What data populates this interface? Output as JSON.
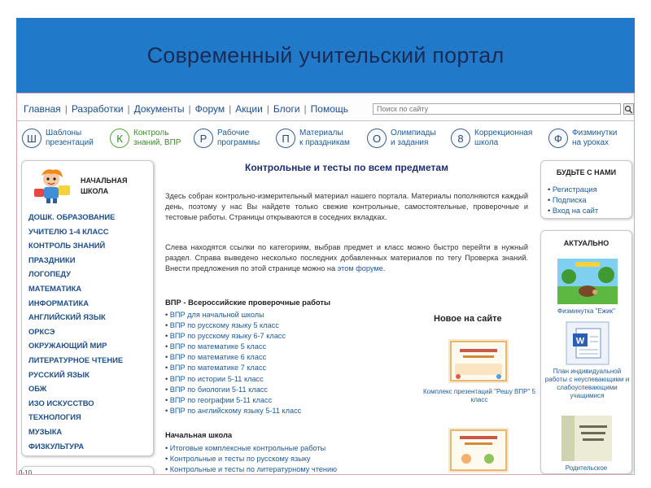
{
  "slide": {
    "title": "Современный учительский портал"
  },
  "topnav": {
    "items": [
      "Главная",
      "Разработки",
      "Документы",
      "Форум",
      "Акции",
      "Блоги",
      "Помощь"
    ],
    "search_placeholder": "Поиск по сайту"
  },
  "categories": [
    {
      "letter": "Ш",
      "line1": "Шаблоны",
      "line2": "презентаций"
    },
    {
      "letter": "К",
      "line1": "Контроль",
      "line2": "знаний, ВПР"
    },
    {
      "letter": "Р",
      "line1": "Рабочие",
      "line2": "программы"
    },
    {
      "letter": "П",
      "line1": "Материалы",
      "line2": "к праздникам"
    },
    {
      "letter": "О",
      "line1": "Олимпиады",
      "line2": "и задания"
    },
    {
      "letter": "8",
      "line1": "Коррекционная",
      "line2": "школа"
    },
    {
      "letter": "Ф",
      "line1": "Физминутки",
      "line2": "на уроках"
    }
  ],
  "left": {
    "title_line1": "НАЧАЛЬНАЯ",
    "title_line2": "ШКОЛА",
    "menu": [
      "ДОШК. ОБРАЗОВАНИЕ",
      "УЧИТЕЛЮ 1-4 КЛАСС",
      "КОНТРОЛЬ ЗНАНИЙ",
      "ПРАЗДНИКИ",
      "ЛОГОПЕДУ",
      "МАТЕМАТИКА",
      "ИНФОРМАТИКА",
      "АНГЛИЙСКИЙ ЯЗЫК",
      "ОРКСЭ",
      "ОКРУЖАЮЩИЙ МИР",
      "ЛИТЕРАТУРНОЕ ЧТЕНИЕ",
      "РУССКИЙ ЯЗЫК",
      "ОБЖ",
      "ИЗО ИСКУССТВО",
      "ТЕХНОЛОГИЯ",
      "МУЗЫКА",
      "ФИЗКУЛЬТУРА"
    ],
    "counter": "0-10"
  },
  "main": {
    "title": "Контрольные и тесты по всем предметам",
    "intro1": "Здесь собран контрольно-измерительный материал нашего портала. Материалы пополняются каждый день, поэтому у нас Вы найдете только свежие контрольные, самостоятельные, проверочные и тестовые работы. Страницы открываются в соседних вкладках.",
    "intro2_text": "Слева находятся ссылки по категориям, выбрав предмет и класс можно быстро перейти в нужный раздел. Справа выведено несколько последних добавленных материалов по тегу Проверка знаний. Внести предложения по этой странице можно на ",
    "intro2_link": "этом форуме",
    "intro2_end": ".",
    "vpr_heading": "ВПР - Всероссийские проверочные работы",
    "vpr_links": [
      "ВПР для начальной школы",
      "ВПР по русскому языку 5 класс",
      "ВПР по русскому языку 6-7 класс",
      "ВПР по математике 5 класс",
      "ВПР по математике 6 класс",
      "ВПР по математике 7 класс",
      "ВПР по истории 5-11 класс",
      "ВПР по биологии 5-11 класс",
      "ВПР по географии 5-11 класс",
      "ВПР по английскому языку 5-11 класс"
    ],
    "new_heading": "Новое на сайте",
    "new_caption1": "Комплекс презентаций \"Решу ВПР\" 5 класс",
    "ns_heading": "Начальная школа",
    "ns_links": [
      "Итоговые комплексные контрольные работы",
      "Контрольные и тесты по русскому языку",
      "Контрольные и тесты по литературному чтению"
    ]
  },
  "right": {
    "join_title": "БУДЬТЕ С НАМИ",
    "join_links": [
      "Регистрация",
      "Подписка",
      "Вход на сайт"
    ],
    "actual_title": "АКТУАЛЬНО",
    "actual_caption1": "Физминутка \"Ежик\"",
    "actual_caption2": "План индивидуальной работы с неуспевающими и слабоуспевающими учащимися",
    "actual_caption3": "Родительское"
  }
}
